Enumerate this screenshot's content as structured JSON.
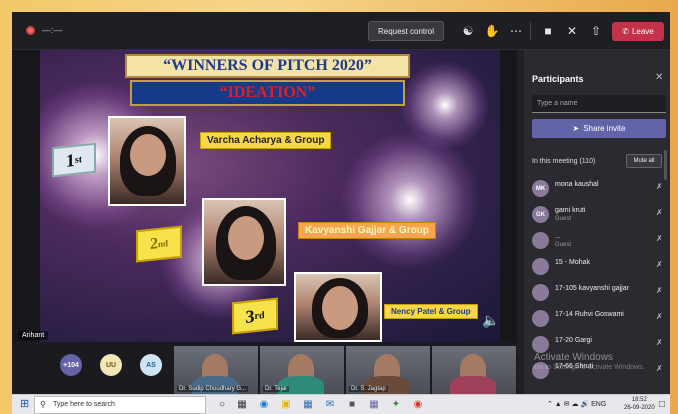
{
  "topbar": {
    "timer": "—:—",
    "request_control": "Request control",
    "leave": "Leave",
    "icons": [
      "participants-icon",
      "raise-hand-icon",
      "more-icon",
      "camera-icon",
      "mic-off-icon",
      "share-tray-icon",
      "phone-icon"
    ]
  },
  "slide": {
    "title": "“WINNERS OF PITCH 2020”",
    "subtitle": "“IDEATION”",
    "winners": [
      {
        "rank_num": "1",
        "rank_sup": "st",
        "name": "Varcha Acharya & Group"
      },
      {
        "rank_num": "2",
        "rank_sup": "nd",
        "name": "Kavyanshi Gajjar & Group"
      },
      {
        "rank_num": "3",
        "rank_sup": "rd",
        "name": "Nency Patel & Group"
      }
    ],
    "presenter": "Arihant"
  },
  "strip": {
    "avatars": [
      {
        "label": "+104",
        "bg": "#6264a7",
        "fg": "#ffffff"
      },
      {
        "label": "UU",
        "bg": "#f1e7b6",
        "fg": "#6b5a10"
      },
      {
        "label": "AS",
        "bg": "#cfe4f7",
        "fg": "#1e5b8a"
      }
    ],
    "videos": [
      {
        "name": "Dr. Sudip Choudhary G..."
      },
      {
        "name": "Dr. Tejal"
      },
      {
        "name": "Dr. S. Jagtap"
      },
      {
        "name": ""
      }
    ]
  },
  "panel": {
    "title": "Participants",
    "search_placeholder": "Type a name",
    "share_invite": "Share invite",
    "in_meeting": "In this meeting (110)",
    "mute_all": "Mute all",
    "participants": [
      {
        "initials": "MK",
        "name": "mona kaushal",
        "sub": ""
      },
      {
        "initials": "GK",
        "name": "gami kruti",
        "sub": "Guest"
      },
      {
        "initials": "",
        "name": "...",
        "sub": "Guest"
      },
      {
        "initials": "",
        "name": "15 - Mohak",
        "sub": ""
      },
      {
        "initials": "",
        "name": "17-105 kavyanshi gajjar",
        "sub": ""
      },
      {
        "initials": "",
        "name": "17-14 Ruhvi Goswami",
        "sub": ""
      },
      {
        "initials": "",
        "name": "17-20 Gargi",
        "sub": ""
      },
      {
        "initials": "",
        "name": "17-66 Shruti",
        "sub": ""
      }
    ]
  },
  "watermark": {
    "line1": "Activate Windows",
    "line2": "Go to Settings to activate Windows."
  },
  "taskbar": {
    "search_placeholder": "Type here to search",
    "tray_text": "ENG",
    "time": "18:52",
    "date": "26-09-2020"
  }
}
